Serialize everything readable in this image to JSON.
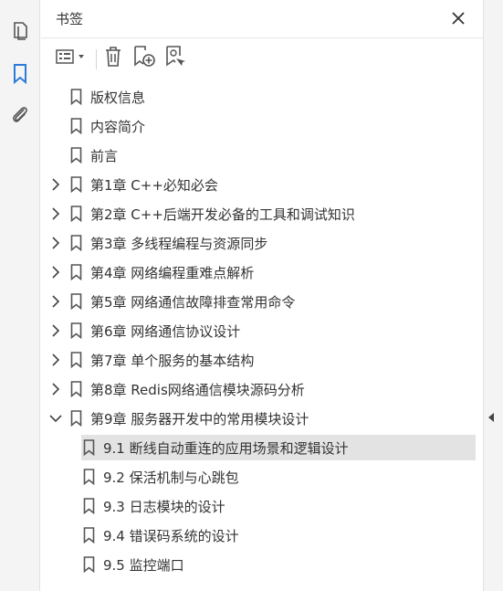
{
  "panel": {
    "title": "书签"
  },
  "rail": {
    "items": [
      {
        "icon": "pages-icon"
      },
      {
        "icon": "bookmark-icon"
      },
      {
        "icon": "attachment-icon"
      }
    ]
  },
  "toolbar": {
    "items": [
      {
        "icon": "options-menu-icon"
      },
      {
        "icon": "delete-icon"
      },
      {
        "icon": "new-bookmark-icon"
      },
      {
        "icon": "bookmark-search-icon"
      }
    ]
  },
  "bookmarks": [
    {
      "label": "版权信息",
      "expandable": false,
      "expanded": false,
      "level": 0,
      "selected": false
    },
    {
      "label": "内容简介",
      "expandable": false,
      "expanded": false,
      "level": 0,
      "selected": false
    },
    {
      "label": "前言",
      "expandable": false,
      "expanded": false,
      "level": 0,
      "selected": false
    },
    {
      "label": "第1章 C++必知必会",
      "expandable": true,
      "expanded": false,
      "level": 0,
      "selected": false
    },
    {
      "label": "第2章 C++后端开发必备的工具和调试知识",
      "expandable": true,
      "expanded": false,
      "level": 0,
      "selected": false
    },
    {
      "label": "第3章 多线程编程与资源同步",
      "expandable": true,
      "expanded": false,
      "level": 0,
      "selected": false
    },
    {
      "label": "第4章 网络编程重难点解析",
      "expandable": true,
      "expanded": false,
      "level": 0,
      "selected": false
    },
    {
      "label": "第5章 网络通信故障排查常用命令",
      "expandable": true,
      "expanded": false,
      "level": 0,
      "selected": false
    },
    {
      "label": "第6章 网络通信协议设计",
      "expandable": true,
      "expanded": false,
      "level": 0,
      "selected": false
    },
    {
      "label": "第7章 单个服务的基本结构",
      "expandable": true,
      "expanded": false,
      "level": 0,
      "selected": false
    },
    {
      "label": "第8章 Redis网络通信模块源码分析",
      "expandable": true,
      "expanded": false,
      "level": 0,
      "selected": false
    },
    {
      "label": "第9章 服务器开发中的常用模块设计",
      "expandable": true,
      "expanded": true,
      "level": 0,
      "selected": false
    },
    {
      "label": "9.1 断线自动重连的应用场景和逻辑设计",
      "expandable": false,
      "expanded": false,
      "level": 1,
      "selected": true
    },
    {
      "label": "9.2 保活机制与心跳包",
      "expandable": false,
      "expanded": false,
      "level": 1,
      "selected": false
    },
    {
      "label": "9.3 日志模块的设计",
      "expandable": false,
      "expanded": false,
      "level": 1,
      "selected": false
    },
    {
      "label": "9.4 错误码系统的设计",
      "expandable": false,
      "expanded": false,
      "level": 1,
      "selected": false
    },
    {
      "label": "9.5 监控端口",
      "expandable": false,
      "expanded": false,
      "level": 1,
      "selected": false
    }
  ],
  "colors": {
    "accent": "#2d7bd8",
    "icon": "#555555",
    "selected_bg": "#e3e3e3"
  }
}
